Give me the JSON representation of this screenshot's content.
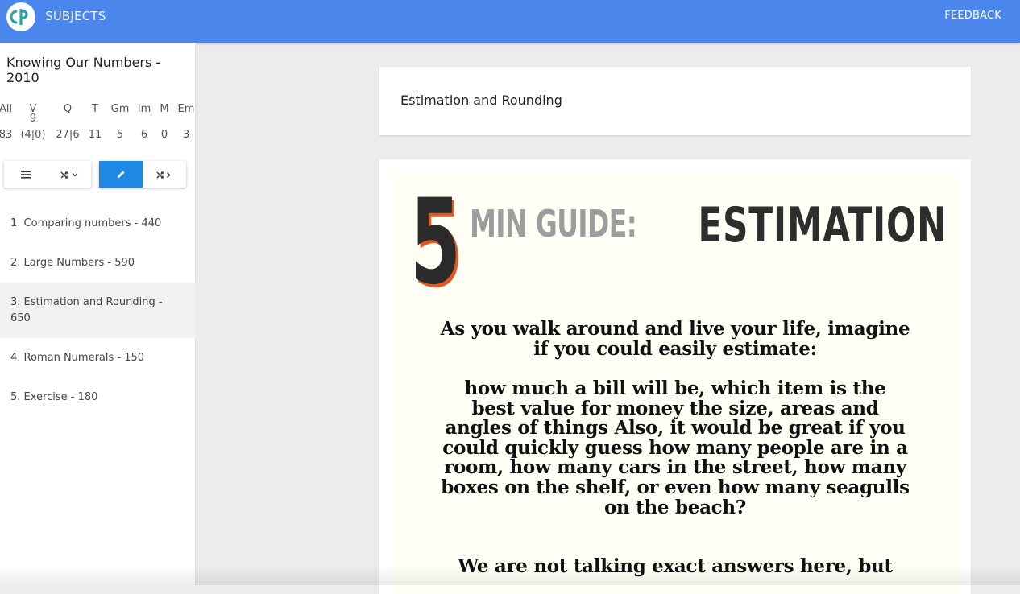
{
  "header": {
    "brand": "SUBJECTS",
    "feedback": "FEEDBACK",
    "logo_icon": "cp-logo-icon",
    "accent": "#4a86ec"
  },
  "sidebar": {
    "course_title": "Knowing Our Numbers - 2010",
    "stats": [
      {
        "label": "All",
        "value": "83"
      },
      {
        "label": "V",
        "value": "9 (4|0)"
      },
      {
        "label": "Q",
        "value": "27|6"
      },
      {
        "label": "T",
        "value": "11"
      },
      {
        "label": "Gm",
        "value": "5"
      },
      {
        "label": "Im",
        "value": "6"
      },
      {
        "label": "M",
        "value": "0"
      },
      {
        "label": "Em",
        "value": "3"
      }
    ],
    "modebar_left": [
      {
        "icon": "list-icon"
      },
      {
        "icon": "shuffle-dropdown-icon"
      }
    ],
    "modebar_right": [
      {
        "icon": "pencil-icon",
        "active": true
      },
      {
        "icon": "shuffle-next-icon"
      }
    ],
    "lessons": [
      {
        "label": "1. Comparing numbers - 440"
      },
      {
        "label": "2. Large Numbers - 590"
      },
      {
        "label": "3. Estimation and Rounding - 650",
        "active": true
      },
      {
        "label": "4. Roman Numerals - 150"
      },
      {
        "label": "5. Exercise - 180"
      }
    ]
  },
  "main": {
    "title": "Estimation and Rounding",
    "poster": {
      "big_number": "5",
      "min_guide": "MIN GUIDE:",
      "heading": "ESTIMATION",
      "para1": "As you walk around and live your life, imagine if you could easily estimate:",
      "para2": "how much a bill will be, which item is the best value for money the size, areas and angles of things Also, it would be great if you could quickly guess how many people are in a room, how many cars in the street, how many boxes on the shelf, or even how many seagulls on the beach?",
      "para3": "We are not talking exact answers here, but"
    }
  }
}
